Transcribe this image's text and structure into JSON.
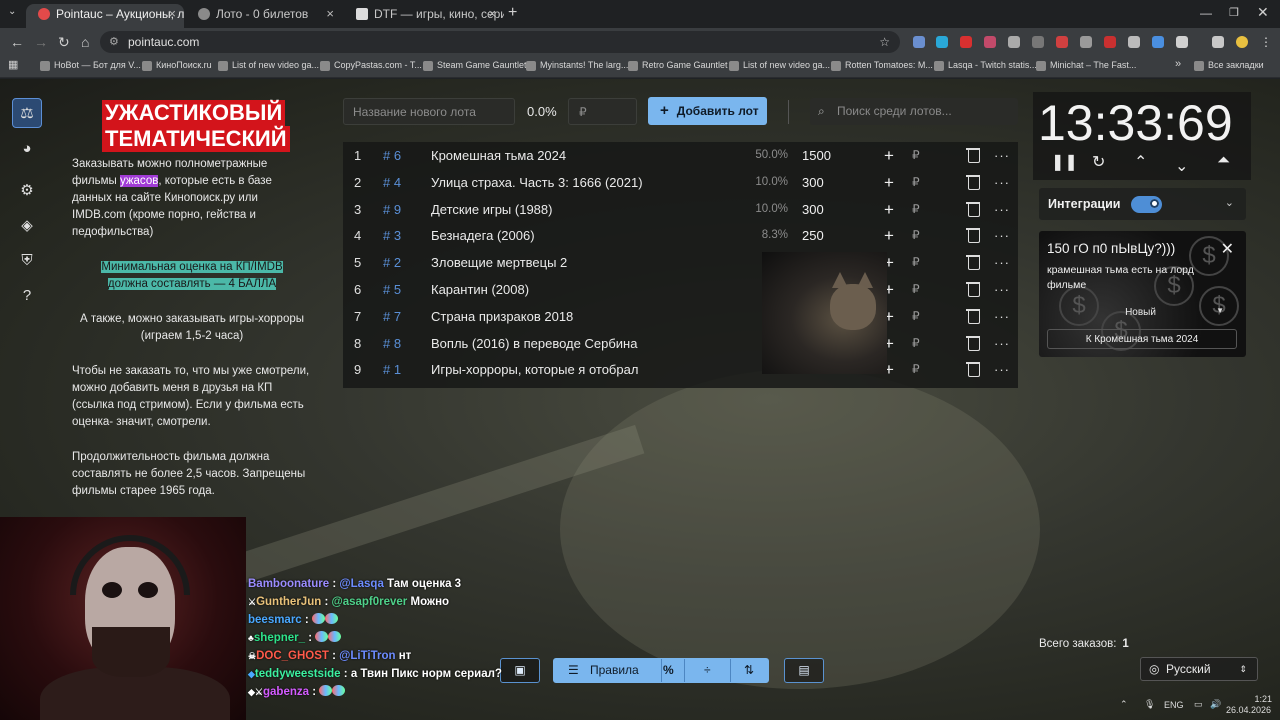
{
  "browser": {
    "tabs": [
      {
        "title": "Pointauc – Аукционы, лотерея",
        "active": true
      },
      {
        "title": "Лото - 0 билетов",
        "active": false
      },
      {
        "title": "DTF — игры, кино, сериалы, р",
        "active": false
      }
    ],
    "new_tab": "+",
    "url": "pointauc.com",
    "bookmarks": [
      "HoBot — Бот для V...",
      "КиноПоиск.ru",
      "List of new video ga...",
      "CopyPastas.com - T...",
      "Steam Game Gauntlet",
      "Myinstants! The larg...",
      "Retro Game Gauntlet",
      "List of new video ga...",
      "Rotten Tomatoes: M...",
      "Lasqa - Twitch statis...",
      "Minichat – The Fast..."
    ],
    "all_bookmarks": "Все закладки",
    "bookmarks_more": "»"
  },
  "rules": {
    "title_line1": "УЖАСТИКОВЫЙ",
    "title_line2": "ТЕМАТИЧЕСКИЙ",
    "p1_before": "Заказывать можно полнометражные фильмы ",
    "p1_highlight": "ужасов",
    "p1_after": ", которые есть в базе данных на сайте Кинопоиск.ру или IMDB.com (кроме порно, гейства и педофильства)",
    "p2": "Минимальная оценка на КП/IMDB должна составлять — 4 БАЛЛА",
    "p3": "А также, можно заказывать игры-хорроры (играем 1,5-2 часа)",
    "p4": "Чтобы не заказать то, что мы уже смотрели, можно добавить меня в друзья на КП (ссылка под стримом). Если у фильма есть оценка- значит, смотрели.",
    "p5": "Продолжительность фильма должна составлять не более 2,5 часов. Запрещены фильмы старее 1965 года."
  },
  "controls": {
    "lot_placeholder": "Название нового лота",
    "percent": "0.0%",
    "rub_placeholder": "₽",
    "add_button": "Добавить лот",
    "search_placeholder": "Поиск среди лотов..."
  },
  "lots": [
    {
      "num": "1",
      "id": "# 6",
      "name": "Кромешная тьма 2024",
      "pct": "50.0%",
      "amount": "1500"
    },
    {
      "num": "2",
      "id": "# 4",
      "name": "Улица страха. Часть 3: 1666 (2021)",
      "pct": "10.0%",
      "amount": "300"
    },
    {
      "num": "3",
      "id": "# 9",
      "name": "Детские игры (1988)",
      "pct": "10.0%",
      "amount": "300"
    },
    {
      "num": "4",
      "id": "# 3",
      "name": "Безнадега (2006)",
      "pct": "8.3%",
      "amount": "250"
    },
    {
      "num": "5",
      "id": "# 2",
      "name": "Зловещие мертвецы 2",
      "pct": "",
      "amount": ""
    },
    {
      "num": "6",
      "id": "# 5",
      "name": "Карантин (2008)",
      "pct": "",
      "amount": ""
    },
    {
      "num": "7",
      "id": "# 7",
      "name": "Страна призраков 2018",
      "pct": "",
      "amount": ""
    },
    {
      "num": "8",
      "id": "# 8",
      "name": "Вопль (2016) в переводе Сербина",
      "pct": "",
      "amount": ""
    },
    {
      "num": "9",
      "id": "# 1",
      "name": "Игры-хорроры, которые я отобрал",
      "pct": "0.0%",
      "amount": "0"
    }
  ],
  "row_actions": {
    "plus": "+",
    "rub": "₽",
    "more": "···"
  },
  "timer": {
    "value": "13:33:69"
  },
  "integrations": {
    "label": "Интеграции",
    "enabled": true
  },
  "donation": {
    "header": "150 гО п0 пЫвЦу?)))",
    "message": "крамешная тьма есть на лорд фильме",
    "status": "Новый",
    "target": "К Кромешная тьма 2024"
  },
  "total": {
    "label": "Всего заказов:",
    "value": "1"
  },
  "language": "Русский",
  "bottom_toolbar": {
    "rules_label": "Правила",
    "percent_icon": "%"
  },
  "chat": [
    {
      "user": "Bamboonature",
      "mention": "@Lasqa",
      "text": "Там оценка 3"
    },
    {
      "user": "GuntherJun",
      "mention": "@asapf0rever",
      "text": "Можно"
    },
    {
      "user": "beesmarc",
      "mention": "",
      "text": ""
    },
    {
      "user": "shepner_",
      "mention": "",
      "text": ""
    },
    {
      "user": "DOC_GHOST",
      "mention": "@LiTiTron",
      "text": "нт"
    },
    {
      "user": "teddyweestside",
      "mention": "",
      "text": "а Твин Пикс норм сериал?"
    },
    {
      "user": "gabenza",
      "mention": "",
      "text": ""
    }
  ],
  "tray": {
    "lang": "ENG",
    "time": "1:21",
    "date": "26.04.2026"
  }
}
